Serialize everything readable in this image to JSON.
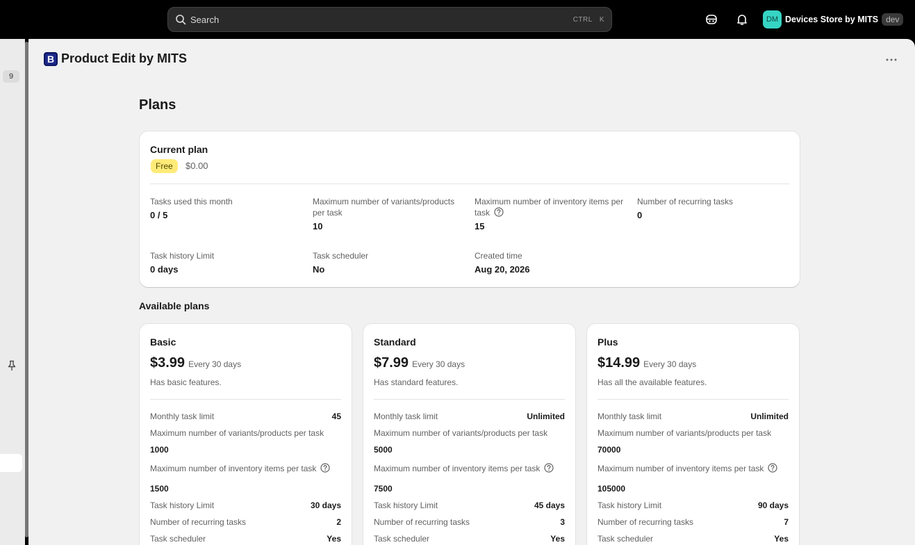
{
  "topbar": {
    "search_placeholder": "Search",
    "shortcut_ctrl": "CTRL",
    "shortcut_key": "K",
    "avatar_initials": "DM",
    "store_name": "Devices Store by MITS",
    "env_badge": "dev"
  },
  "rail": {
    "badge": "9"
  },
  "app": {
    "logo_letter": "B",
    "title": "Product Edit by MITS"
  },
  "page": {
    "title": "Plans"
  },
  "current_plan": {
    "title": "Current plan",
    "badge": "Free",
    "price": "$0.00",
    "stats": [
      {
        "label": "Tasks used this month",
        "value": "0 / 5"
      },
      {
        "label": "Maximum number of variants/products per task",
        "value": "10"
      },
      {
        "label": "Maximum number of inventory items per task",
        "value": "15"
      },
      {
        "label": "Number of recurring tasks",
        "value": "0"
      },
      {
        "label": "Task history Limit",
        "value": "0 days"
      },
      {
        "label": "Task scheduler",
        "value": "No"
      },
      {
        "label": "Created time",
        "value": "Aug 20, 2026"
      }
    ]
  },
  "available": {
    "title": "Available plans",
    "labels": {
      "monthly": "Monthly task limit",
      "variants": "Maximum number of variants/products per task",
      "inventory": "Maximum number of inventory items per task",
      "history": "Task history Limit",
      "recurring": "Number of recurring tasks",
      "scheduler": "Task scheduler"
    },
    "plans": [
      {
        "name": "Basic",
        "price": "$3.99",
        "period": "Every 30 days",
        "desc": "Has basic features.",
        "monthly": "45",
        "variants": "1000",
        "inventory": "1500",
        "history": "30 days",
        "recurring": "2",
        "scheduler": "Yes"
      },
      {
        "name": "Standard",
        "price": "$7.99",
        "period": "Every 30 days",
        "desc": "Has standard features.",
        "monthly": "Unlimited",
        "variants": "5000",
        "inventory": "7500",
        "history": "45 days",
        "recurring": "3",
        "scheduler": "Yes"
      },
      {
        "name": "Plus",
        "price": "$14.99",
        "period": "Every 30 days",
        "desc": "Has all the available features.",
        "monthly": "Unlimited",
        "variants": "70000",
        "inventory": "105000",
        "history": "90 days",
        "recurring": "7",
        "scheduler": "Yes"
      }
    ]
  }
}
